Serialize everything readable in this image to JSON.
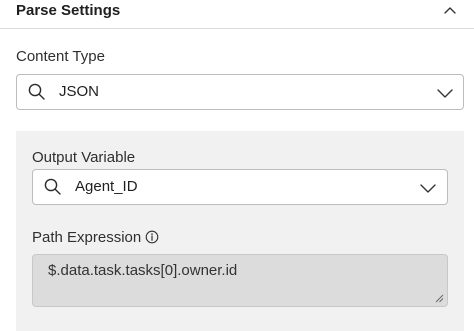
{
  "header": {
    "title": "Parse Settings",
    "collapse_icon": "chevron-up-icon"
  },
  "content_type": {
    "label": "Content Type",
    "value": "JSON",
    "search_icon": "search-icon",
    "dropdown_icon": "chevron-down-icon"
  },
  "output_variable": {
    "label": "Output Variable",
    "value": "Agent_ID",
    "search_icon": "search-icon",
    "dropdown_icon": "chevron-down-icon"
  },
  "path_expression": {
    "label": "Path Expression",
    "info_icon": "info-icon",
    "value": "$.data.task.tasks[0].owner.id"
  },
  "colors": {
    "panel_background": "#f1f1f1",
    "textarea_background": "#dcdcdc",
    "border": "#bdbdbd"
  }
}
